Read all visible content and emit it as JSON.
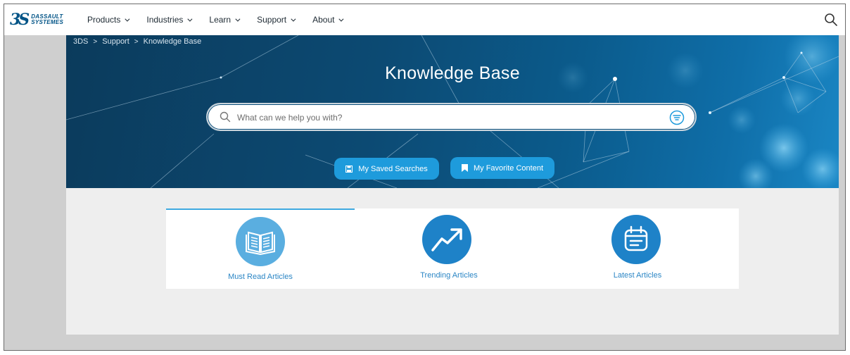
{
  "logo": {
    "mark": "3S",
    "line1": "DASSAULT",
    "line2": "SYSTEMES"
  },
  "nav": {
    "items": [
      {
        "label": "Products"
      },
      {
        "label": "Industries"
      },
      {
        "label": "Learn"
      },
      {
        "label": "Support"
      },
      {
        "label": "About"
      }
    ],
    "search_icon": "search-icon"
  },
  "breadcrumb": {
    "items": [
      "3DS",
      "Support",
      "Knowledge Base"
    ],
    "separator": ">"
  },
  "hero": {
    "title": "Knowledge Base",
    "search_placeholder": "What can we help you with?",
    "search_value": "",
    "buttons": {
      "saved": "My Saved Searches",
      "favorite": "My Favorite Content"
    }
  },
  "cards": [
    {
      "label": "Must Read Articles",
      "icon": "open-book-icon",
      "color": "#5aaee0"
    },
    {
      "label": "Trending Articles",
      "icon": "trending-up-icon",
      "color": "#1e82c8"
    },
    {
      "label": "Latest Articles",
      "icon": "calendar-icon",
      "color": "#1e82c8"
    }
  ],
  "colors": {
    "accent": "#1e9bdc",
    "brand": "#005386",
    "active_tab": "#3fa9e0"
  }
}
